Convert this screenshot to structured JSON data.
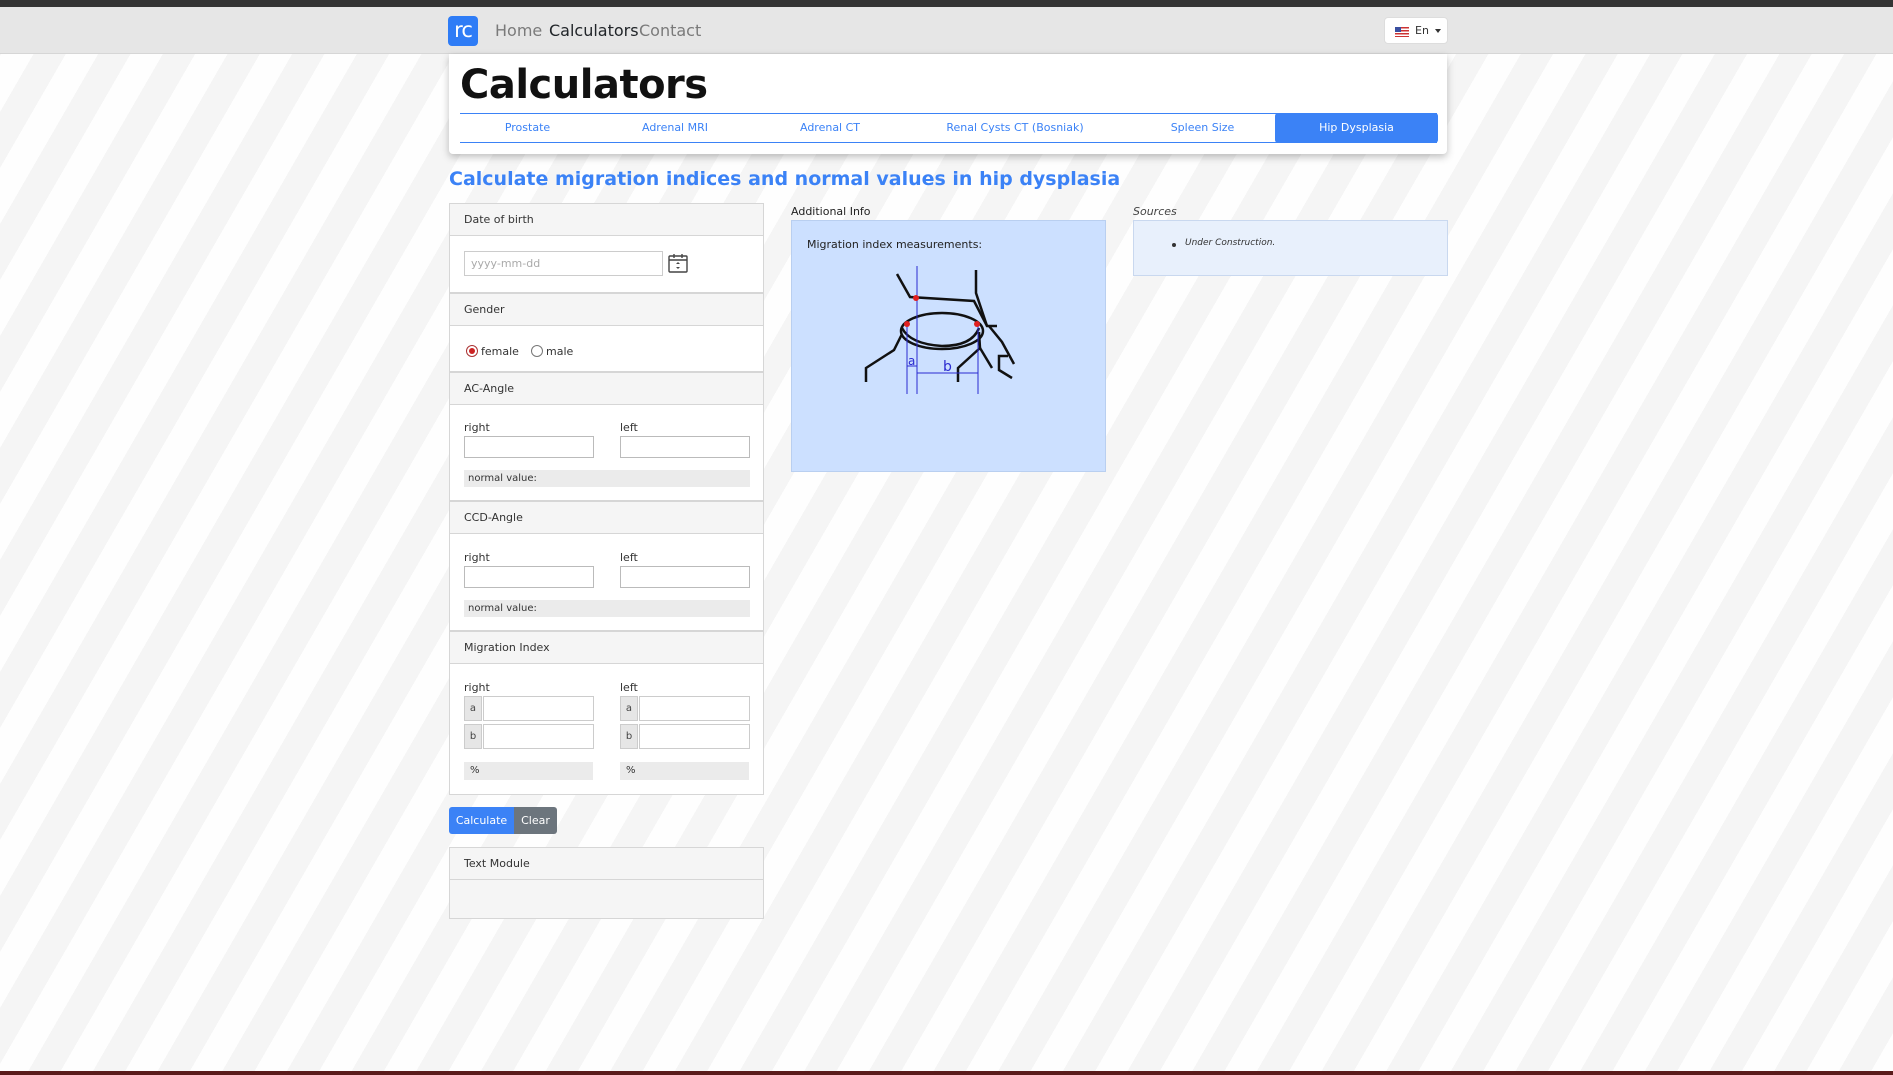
{
  "nav": {
    "brand": "rc",
    "links": [
      "Home",
      "Calculators",
      "Contact"
    ],
    "active": "Calculators",
    "language": "En"
  },
  "header": {
    "title": "Calculators",
    "tabs": [
      "Prostate",
      "Adrenal MRI",
      "Adrenal CT",
      "Renal Cysts CT (Bosniak)",
      "Spleen Size",
      "Hip Dysplasia"
    ],
    "active_tab": "Hip Dysplasia"
  },
  "page_title": "Calculate migration indices and normal values in hip dysplasia",
  "dob": {
    "label": "Date of birth",
    "placeholder": "yyyy-mm-dd"
  },
  "gender": {
    "label": "Gender",
    "options": [
      "female",
      "male"
    ],
    "selected": "female"
  },
  "ac_angle": {
    "label": "AC-Angle",
    "right": "right",
    "left": "left",
    "normal": "normal value:"
  },
  "ccd_angle": {
    "label": "CCD-Angle",
    "right": "right",
    "left": "left",
    "normal": "normal value:"
  },
  "migration": {
    "label": "Migration Index",
    "right": "right",
    "left": "left",
    "a": "a",
    "b": "b",
    "unit": "%"
  },
  "buttons": {
    "calculate": "Calculate",
    "clear": "Clear"
  },
  "text_module": {
    "label": "Text Module"
  },
  "info": {
    "title": "Additional Info",
    "caption": "Migration index measurements:",
    "diagram_a": "a",
    "diagram_b": "b"
  },
  "sources": {
    "title": "Sources",
    "items": [
      "Under Construction."
    ]
  },
  "colors": {
    "accent": "#3b82f6",
    "info_bg": "#cce0ff",
    "source_bg": "#e8f0fc",
    "clear_btn": "#6c757d"
  }
}
